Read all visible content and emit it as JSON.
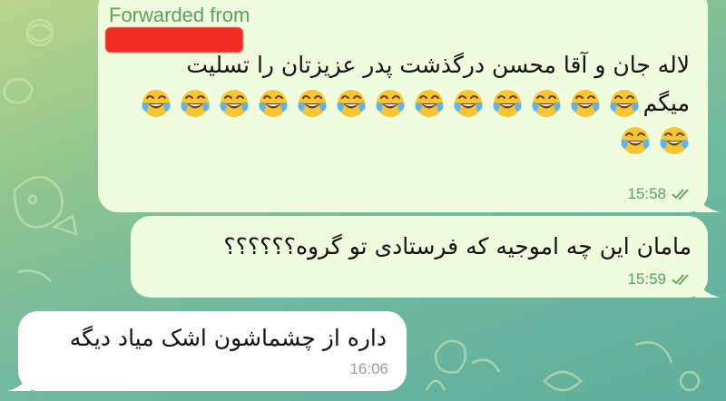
{
  "chat": {
    "messages": [
      {
        "direction": "outgoing",
        "forwarded_label": "Forwarded from",
        "sender_redacted": true,
        "text_line1": "لاله جان و آقا محسن درگذشت پدر عزیزتان را تسلیت",
        "text_line2_word": "میگم",
        "emoji_line2_count": 13,
        "emoji_line3_count": 2,
        "emoji": "face-with-tears-of-joy",
        "time": "15:58",
        "status": "read-double-check"
      },
      {
        "direction": "outgoing",
        "text": "مامان این چه اموجیه که فرستادی تو گروه؟؟؟؟؟؟",
        "time": "15:59",
        "status": "read-double-check"
      },
      {
        "direction": "incoming",
        "text": "داره از چشماشون اشک میاد دیگه",
        "time": "16:06"
      }
    ]
  },
  "colors": {
    "outgoing_bubble": "#effdde",
    "incoming_bubble": "#ffffff",
    "accent_green": "#5aa062",
    "redaction": "#f12a22",
    "time_incoming": "#9a9a9a"
  }
}
